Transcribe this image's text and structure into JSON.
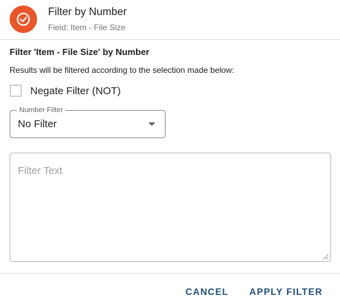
{
  "header": {
    "icon": "check-circle-icon",
    "icon_color": "#e8562a",
    "title": "Filter by Number",
    "subtitle": "Field: Item - File Size"
  },
  "body": {
    "section_title": "Filter 'Item - File Size' by Number",
    "description": "Results will be filtered according to the selection made below:",
    "negate": {
      "label": "Negate Filter (NOT)",
      "checked": false
    },
    "number_filter": {
      "label": "Number Filter",
      "value": "No Filter"
    },
    "filter_text": {
      "placeholder": "Filter Text",
      "value": ""
    }
  },
  "actions": {
    "cancel_label": "CANCEL",
    "apply_label": "APPLY FILTER",
    "accent_color": "#1f4e79"
  }
}
